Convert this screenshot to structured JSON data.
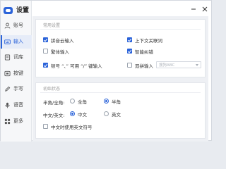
{
  "app": {
    "title": "设置",
    "brand_color": "#2b63d9"
  },
  "window_controls": {
    "minimize_icon": "minimize-icon",
    "close_icon": "close-icon"
  },
  "sidebar": {
    "items": [
      {
        "label": "账号",
        "icon": "user-icon",
        "active": false
      },
      {
        "label": "输入",
        "icon": "keyboard-icon",
        "active": true
      },
      {
        "label": "词库",
        "icon": "dictionary-icon",
        "active": false
      },
      {
        "label": "按键",
        "icon": "key-icon",
        "active": false
      },
      {
        "label": "手写",
        "icon": "pen-icon",
        "active": false
      },
      {
        "label": "语音",
        "icon": "microphone-icon",
        "active": false
      },
      {
        "label": "更多",
        "icon": "grid-icon",
        "active": false
      }
    ]
  },
  "common_settings": {
    "title": "常用设置",
    "options": [
      {
        "label": "拼音云输入",
        "checked": true
      },
      {
        "label": "上下文关联词",
        "checked": true
      },
      {
        "label": "繁体输入",
        "checked": false
      },
      {
        "label": "智能纠错",
        "checked": true
      },
      {
        "label": "顿号 “、” 可用 “/” 键输入",
        "checked": true
      },
      {
        "label": "双拼输入",
        "checked": false
      }
    ],
    "shuangpin_dropdown": {
      "value": "搜狗ABC"
    }
  },
  "initial_state": {
    "title": "初始状态",
    "half_full": {
      "label": "半角/全角:",
      "options": [
        {
          "label": "全角",
          "selected": false
        },
        {
          "label": "半角",
          "selected": true
        }
      ]
    },
    "cn_en": {
      "label": "中文/英文:",
      "options": [
        {
          "label": "中文",
          "selected": true
        },
        {
          "label": "英文",
          "selected": false
        }
      ]
    },
    "punct_option": {
      "label": "中文时使用英文符号",
      "checked": false
    }
  }
}
